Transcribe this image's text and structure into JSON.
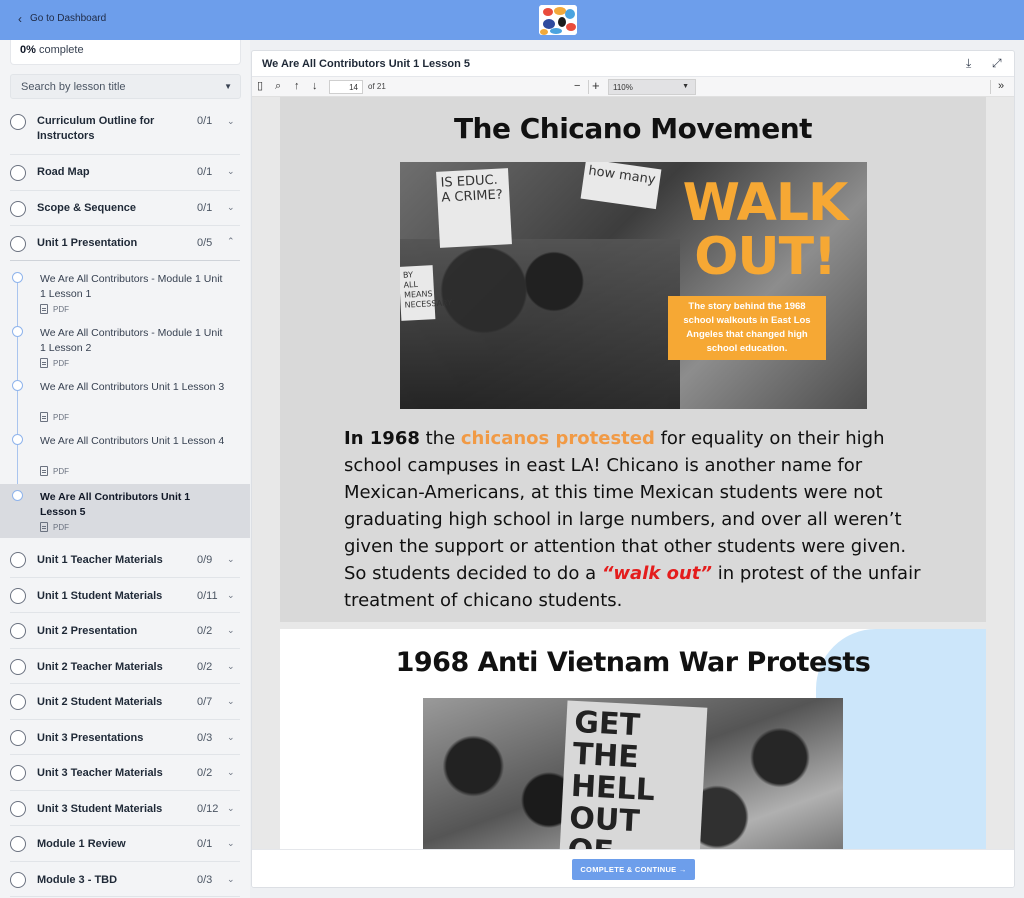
{
  "topbar": {
    "back_label": "Go to Dashboard",
    "logo_colors": [
      "#e94b3c",
      "#f2a93b",
      "#2e4a9e",
      "#4aa3df",
      "#1c1c1c"
    ]
  },
  "sidebar": {
    "progress_percent": "0%",
    "progress_suffix": "complete",
    "search_placeholder": "Search by lesson title",
    "sections": [
      {
        "title": "Curriculum Outline for Instructors",
        "count": "0/1",
        "expanded": false
      },
      {
        "title": "Road Map",
        "count": "0/1",
        "expanded": false
      },
      {
        "title": "Scope & Sequence",
        "count": "0/1",
        "expanded": false
      },
      {
        "title": "Unit 1 Presentation",
        "count": "0/5",
        "expanded": true
      },
      {
        "title": "Unit 1 Teacher Materials",
        "count": "0/9",
        "expanded": false
      },
      {
        "title": "Unit 1 Student Materials",
        "count": "0/11",
        "expanded": false
      },
      {
        "title": "Unit 2 Presentation",
        "count": "0/2",
        "expanded": false
      },
      {
        "title": "Unit 2 Teacher Materials",
        "count": "0/2",
        "expanded": false
      },
      {
        "title": "Unit 2 Student Materials",
        "count": "0/7",
        "expanded": false
      },
      {
        "title": "Unit 3 Presentations",
        "count": "0/3",
        "expanded": false
      },
      {
        "title": "Unit 3 Teacher Materials",
        "count": "0/2",
        "expanded": false
      },
      {
        "title": "Unit 3 Student Materials",
        "count": "0/12",
        "expanded": false
      },
      {
        "title": "Module 1 Review",
        "count": "0/1",
        "expanded": false
      },
      {
        "title": "Module 3 - TBD",
        "count": "0/3",
        "expanded": false
      }
    ],
    "lessons": [
      {
        "title": "We Are All Contributors - Module 1 Unit 1 Lesson 1",
        "type": "PDF",
        "active": false
      },
      {
        "title": "We Are All Contributors - Module 1 Unit 1 Lesson 2",
        "type": "PDF",
        "active": false
      },
      {
        "title": "We Are All Contributors Unit 1 Lesson 3",
        "type": "PDF",
        "active": false
      },
      {
        "title": "We Are All Contributors Unit 1 Lesson 4",
        "type": "PDF",
        "active": false
      },
      {
        "title": "We Are All Contributors Unit 1 Lesson 5",
        "type": "PDF",
        "active": true
      }
    ]
  },
  "main": {
    "title": "We Are All Contributors Unit 1 Lesson 5",
    "toolbar": {
      "page_current": "14",
      "page_total": "of 21",
      "zoom": "110%"
    },
    "page1": {
      "title": "The Chicano Movement",
      "sign_left": "IS EDUC. A CRIME?",
      "sign_top": "how many",
      "sign_small": "BY ALL MEANS NECESSARY",
      "walkout_title": "WALK OUT!",
      "walkout_caption": "The story behind the 1968 school walkouts in East Los Angeles that changed high school education.",
      "text_bold_lead": "In 1968",
      "text_part1": " the ",
      "text_orange": "chicanos protested",
      "text_part2": " for equality on their high school campuses in east LA! Chicano is another name for Mexican-Americans, at this time Mexican students were not graduating high school in large numbers, and over all weren’t given the support or attention that other students were given. So students decided to do a ",
      "text_red": "“walk out”",
      "text_part3": " in protest of the unfair treatment of chicano students."
    },
    "page2": {
      "title": "1968 Anti Vietnam War Protests",
      "sign_text": "GET THE HELL OUT OF VIETNAM"
    },
    "continue_label": "COMPLETE & CONTINUE →"
  }
}
